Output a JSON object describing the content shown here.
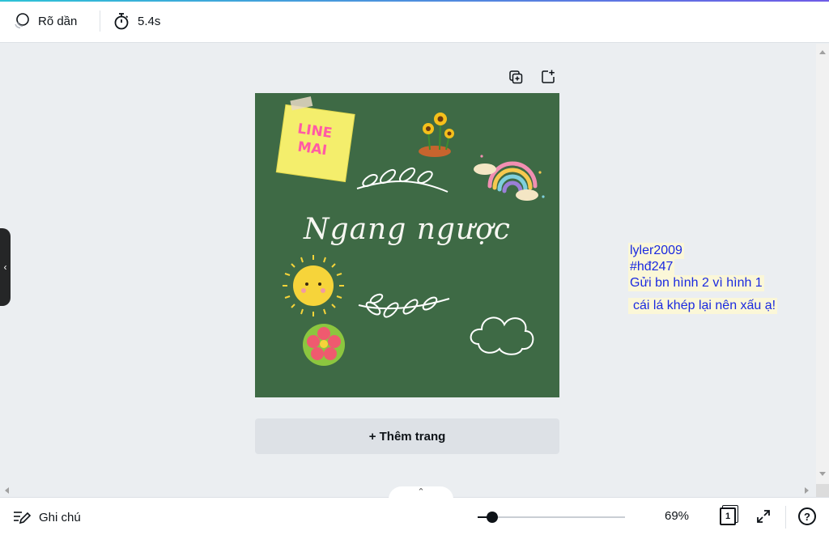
{
  "toolbar": {
    "animation_label": "Rõ dần",
    "timer_label": "5.4s"
  },
  "canvas": {
    "title_text": "Ngang ngược",
    "sticky_note_text": "LINE\nMAI",
    "background_color": "#3e6a45",
    "add_page_label": "+ Thêm trang"
  },
  "annotation": {
    "lines": [
      "lyler2009",
      "#hđ247",
      "Gửi bn hình 2 vì hình 1"
    ],
    "extra_line": "cái lá khép lại nên xấu ạ!",
    "text_color": "#1b2ae0",
    "highlight_color": "#fbf7d8"
  },
  "bottombar": {
    "notes_label": "Ghi chú",
    "zoom_label": "69%",
    "zoom_fraction": 0.1,
    "page_count": "1",
    "help_label": "?",
    "expand_glyph": "⌃"
  },
  "side_tab_glyph": "‹",
  "colors": {
    "accent_start": "#2dc2d6",
    "accent_end": "#6e5be6",
    "workspace": "#ebeef1"
  }
}
